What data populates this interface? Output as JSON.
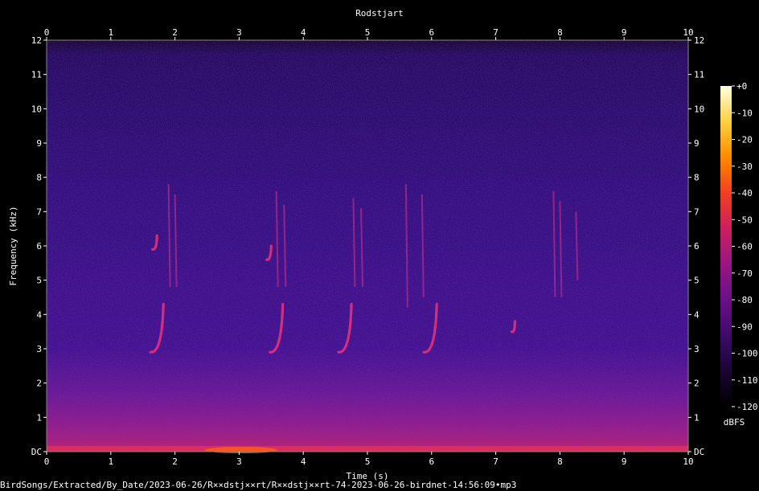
{
  "chart_data": {
    "type": "heatmap",
    "title": "Rodstjart",
    "xlabel": "Time (s)",
    "ylabel": "Frequency (kHz)",
    "x_ticks": [
      "0",
      "1",
      "2",
      "3",
      "4",
      "5",
      "6",
      "7",
      "8",
      "9",
      "10"
    ],
    "y_ticks": [
      "DC",
      "1",
      "2",
      "3",
      "4",
      "5",
      "6",
      "7",
      "8",
      "9",
      "10",
      "11",
      "12"
    ],
    "xlim": [
      0,
      10
    ],
    "ylim": [
      0,
      12
    ],
    "colorbar": {
      "unit": "dBFS",
      "ticks": [
        "+0",
        "-10",
        "-20",
        "-30",
        "-40",
        "-50",
        "-60",
        "-70",
        "-80",
        "-90",
        "-100",
        "-110",
        "-120"
      ],
      "range": [
        -120,
        0
      ],
      "colors": [
        "#000000",
        "#1a0533",
        "#3d0b6b",
        "#6a0f8a",
        "#9a1580",
        "#cc2060",
        "#f04020",
        "#ff8a00",
        "#ffd040",
        "#ffffe0"
      ]
    },
    "background_color": "#2a0a6e",
    "low_band_color": "#c0206a",
    "call_color": "#e0307a",
    "calls": [
      {
        "t_start": 1.62,
        "t_end": 1.82,
        "f_start": 2.9,
        "f_end": 4.3
      },
      {
        "t_start": 3.48,
        "t_end": 3.68,
        "f_start": 2.9,
        "f_end": 4.3
      },
      {
        "t_start": 4.55,
        "t_end": 4.75,
        "f_start": 2.9,
        "f_end": 4.3
      },
      {
        "t_start": 5.88,
        "t_end": 6.08,
        "f_start": 2.9,
        "f_end": 4.3
      },
      {
        "t_start": 1.65,
        "t_end": 1.72,
        "f_start": 5.9,
        "f_end": 6.3
      },
      {
        "t_start": 3.43,
        "t_end": 3.5,
        "f_start": 5.6,
        "f_end": 6.0
      },
      {
        "t_start": 7.25,
        "t_end": 7.3,
        "f_start": 3.5,
        "f_end": 3.8
      }
    ],
    "harmonics": [
      {
        "t": 1.9,
        "f_low": 4.8,
        "f_high": 7.8
      },
      {
        "t": 2.0,
        "f_low": 4.8,
        "f_high": 7.5
      },
      {
        "t": 3.58,
        "f_low": 4.8,
        "f_high": 7.6
      },
      {
        "t": 3.7,
        "f_low": 4.8,
        "f_high": 7.2
      },
      {
        "t": 4.78,
        "f_low": 4.8,
        "f_high": 7.4
      },
      {
        "t": 4.9,
        "f_low": 4.8,
        "f_high": 7.1
      },
      {
        "t": 5.6,
        "f_low": 4.2,
        "f_high": 7.8
      },
      {
        "t": 5.85,
        "f_low": 4.5,
        "f_high": 7.5
      },
      {
        "t": 7.9,
        "f_low": 4.5,
        "f_high": 7.6
      },
      {
        "t": 8.0,
        "f_low": 4.5,
        "f_high": 7.3
      },
      {
        "t": 8.25,
        "f_low": 5.0,
        "f_high": 7.0
      }
    ]
  },
  "footer_path": "BirdSongs/Extracted/By_Date/2023-06-26/R××dstj××rt/R××dstj××rt-74-2023-06-26-birdnet-14:56:09•mp3"
}
